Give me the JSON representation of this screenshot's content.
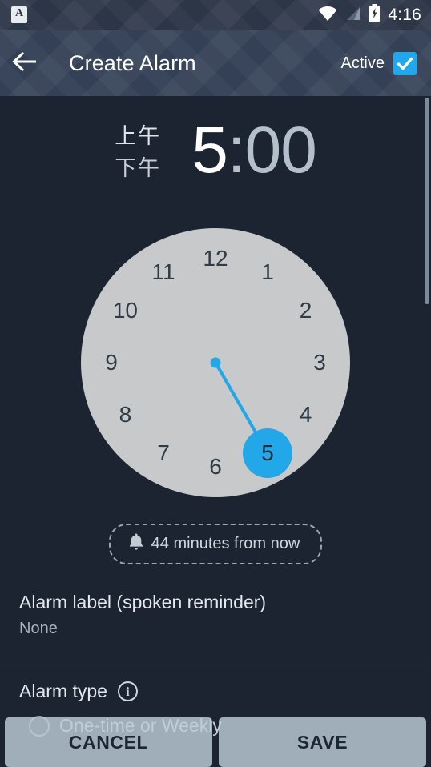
{
  "status_bar": {
    "notification_icon": "app-letter-a-icon",
    "wifi_icon": "wifi-icon",
    "signal_icon": "cell-signal-icon",
    "battery_icon": "battery-charging-icon",
    "time": "4:16"
  },
  "app_bar": {
    "back_icon": "back-arrow-icon",
    "title": "Create Alarm",
    "active_label": "Active",
    "active_checked": true,
    "checkbox_color": "#1fa8ee"
  },
  "time_picker": {
    "am_label": "上午",
    "pm_label": "下午",
    "hour": "5",
    "colon": ":",
    "minute": "00",
    "selected_field": "hour",
    "accent_color": "#22a7e8",
    "dial_face_color": "#c7c9cb",
    "dial_numbers": [
      "12",
      "1",
      "2",
      "3",
      "4",
      "5",
      "6",
      "7",
      "8",
      "9",
      "10",
      "11"
    ],
    "selected_number": "5"
  },
  "chip": {
    "icon": "bell-icon",
    "text": "44 minutes from now"
  },
  "alarm_label_row": {
    "title": "Alarm label (spoken reminder)",
    "value": "None"
  },
  "alarm_type_row": {
    "title": "Alarm type",
    "info_icon": "info-icon",
    "info_glyph": "i",
    "option_label": "One-time or Weekly",
    "option_selected": false
  },
  "buttons": {
    "cancel": "CANCEL",
    "save": "SAVE"
  },
  "colors": {
    "background": "#1b2430",
    "app_bar": "#344056",
    "status_bar": "#2c3647"
  }
}
